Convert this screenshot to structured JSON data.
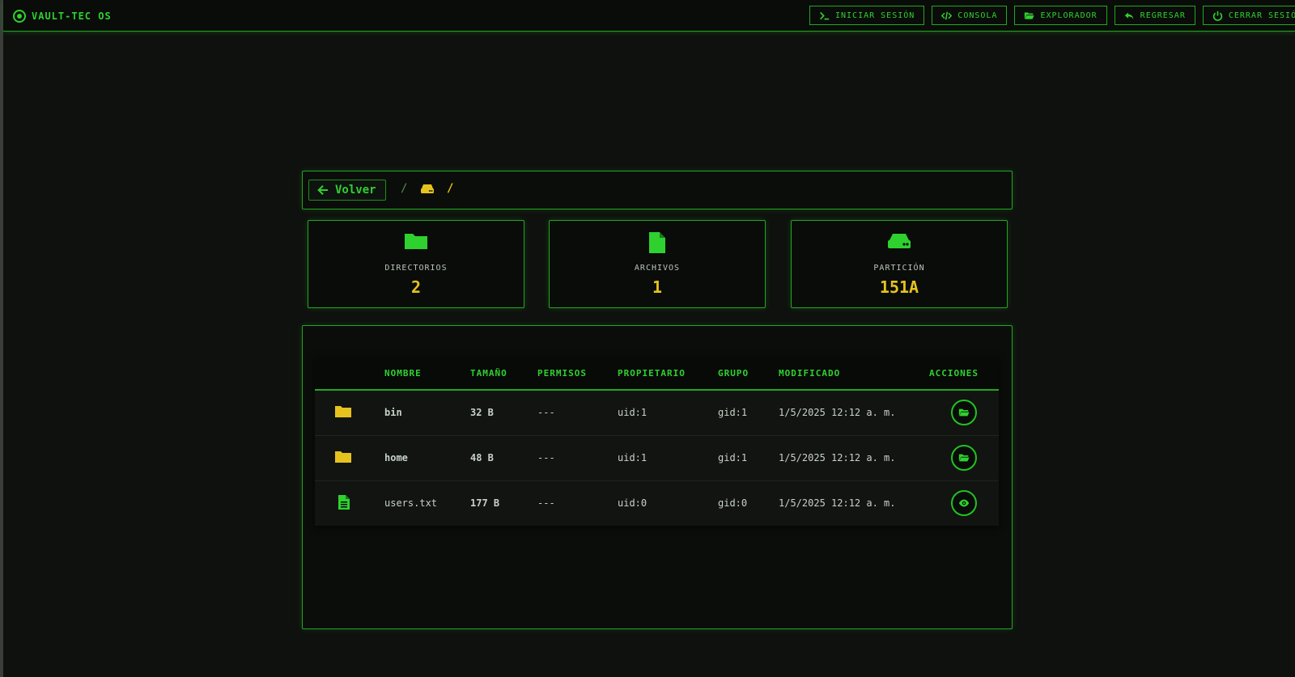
{
  "brand": {
    "title": "VAULT-TEC OS",
    "icon": "radio-target-icon"
  },
  "nav": [
    {
      "label": "INICIAR SESIÓN",
      "icon": "terminal-icon"
    },
    {
      "label": "CONSOLA",
      "icon": "code-icon"
    },
    {
      "label": "EXPLORADOR",
      "icon": "folder-open-icon"
    },
    {
      "label": "REGRESAR",
      "icon": "reply-icon"
    },
    {
      "label": "CERRAR SESIÓN",
      "icon": "power-icon"
    }
  ],
  "breadcrumb": {
    "back_label": "Volver",
    "separator": "/",
    "root_icon": "hard-drive-icon",
    "current": "/"
  },
  "stats": [
    {
      "label": "DIRECTORIOS",
      "value": "2",
      "icon": "folder-icon"
    },
    {
      "label": "ARCHIVOS",
      "value": "1",
      "icon": "file-icon"
    },
    {
      "label": "PARTICIÓN",
      "value": "151A",
      "icon": "hard-drive-icon"
    }
  ],
  "table": {
    "columns": [
      "NOMBRE",
      "TAMAÑO",
      "PERMISOS",
      "PROPIETARIO",
      "GRUPO",
      "MODIFICADO",
      "ACCIONES"
    ],
    "rows": [
      {
        "type": "dir",
        "name": "bin",
        "size": "32 B",
        "perms": "---",
        "owner": "uid:1",
        "group": "gid:1",
        "modified": "1/5/2025 12:12 a. m.",
        "action_icon": "folder-open-icon"
      },
      {
        "type": "dir",
        "name": "home",
        "size": "48 B",
        "perms": "---",
        "owner": "uid:1",
        "group": "gid:1",
        "modified": "1/5/2025 12:12 a. m.",
        "action_icon": "folder-open-icon"
      },
      {
        "type": "file",
        "name": "users.txt",
        "size": "177 B",
        "perms": "---",
        "owner": "uid:0",
        "group": "gid:0",
        "modified": "1/5/2025 12:12 a. m.",
        "action_icon": "eye-icon"
      }
    ]
  },
  "colors": {
    "accent": "#2fd12f",
    "highlight": "#e6c21e",
    "background": "#0f110e"
  }
}
